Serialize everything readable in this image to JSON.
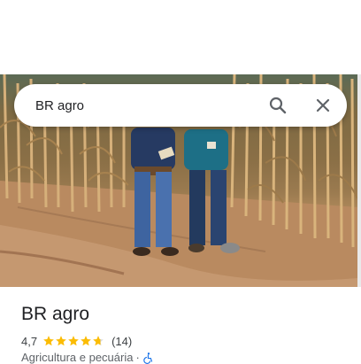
{
  "search": {
    "query": "BR agro"
  },
  "place": {
    "name": "BR agro",
    "rating": "4,7",
    "stars": 4.7,
    "reviews": "(14)",
    "category": "Agricultura e pecuária",
    "separator": "·"
  },
  "colors": {
    "star": "#fbbc04",
    "accessibility": "#1a73e8"
  },
  "icons": {
    "search": "search-icon",
    "close": "close-icon",
    "accessibility": "wheelchair-icon"
  }
}
